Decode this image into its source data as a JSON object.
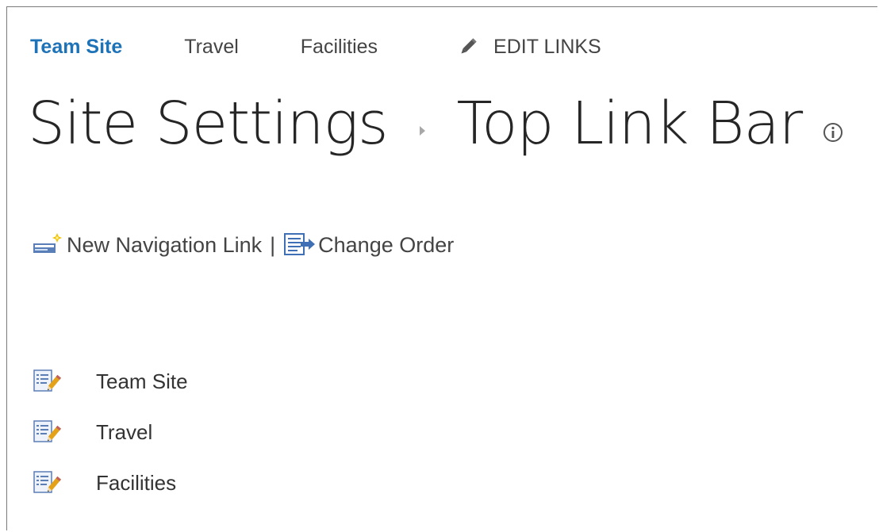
{
  "top_nav": {
    "links": [
      {
        "label": "Team Site",
        "selected": true
      },
      {
        "label": "Travel",
        "selected": false
      },
      {
        "label": "Facilities",
        "selected": false
      }
    ],
    "edit_links_label": "EDIT LINKS",
    "edit_links_icon": "pencil-icon"
  },
  "page_title": {
    "parent": "Site Settings",
    "current": "Top Link Bar",
    "info_icon": "info-icon"
  },
  "toolbar": {
    "new_link_label": "New Navigation Link",
    "separator": "|",
    "change_order_label": "Change Order",
    "new_link_icon": "new-link-icon",
    "change_order_icon": "change-order-icon"
  },
  "nav_items": [
    {
      "label": "Team Site",
      "icon": "edit-icon"
    },
    {
      "label": "Travel",
      "icon": "edit-icon"
    },
    {
      "label": "Facilities",
      "icon": "edit-icon"
    }
  ],
  "colors": {
    "selected_link": "#1e73b8",
    "text": "#444444",
    "title": "#262626"
  }
}
